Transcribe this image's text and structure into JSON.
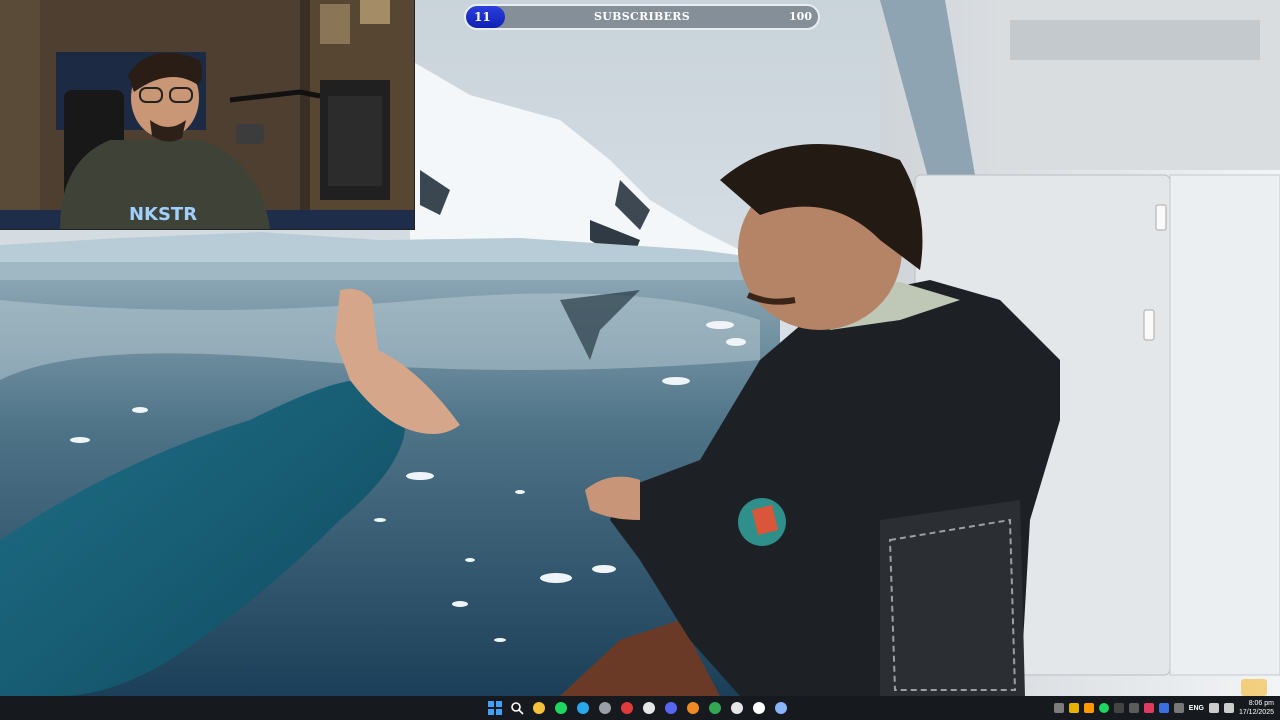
{
  "subscriber_goal": {
    "current": "11",
    "label": "SUBSCRIBERS",
    "goal": "100",
    "progress": 0.11
  },
  "webcam": {
    "hoodie_text": "NKSTR"
  },
  "taskbar": {
    "apps": [
      {
        "name": "start-icon",
        "color": "#3fa2ff"
      },
      {
        "name": "search-icon",
        "color": "#ffffff"
      },
      {
        "name": "file-explorer-icon",
        "color": "#f5c33b"
      },
      {
        "name": "spotify-icon",
        "color": "#1ed760"
      },
      {
        "name": "telegram-icon",
        "color": "#29a9eb"
      },
      {
        "name": "xbox-icon",
        "color": "#9aa0a6"
      },
      {
        "name": "recorder-icon",
        "color": "#e03a3a"
      },
      {
        "name": "epic-games-icon",
        "color": "#e6e6e6"
      },
      {
        "name": "discord-icon",
        "color": "#5865f2"
      },
      {
        "name": "vlc-icon",
        "color": "#f08a24"
      },
      {
        "name": "chrome-icon",
        "color": "#34a853"
      },
      {
        "name": "github-icon",
        "color": "#e6e6e6"
      },
      {
        "name": "clock-icon",
        "color": "#ffffff"
      },
      {
        "name": "settings-icon",
        "color": "#8ab4f8"
      }
    ],
    "tray": {
      "language": "ENG",
      "time": "8:06 pm",
      "date": "17/12/2025"
    }
  }
}
